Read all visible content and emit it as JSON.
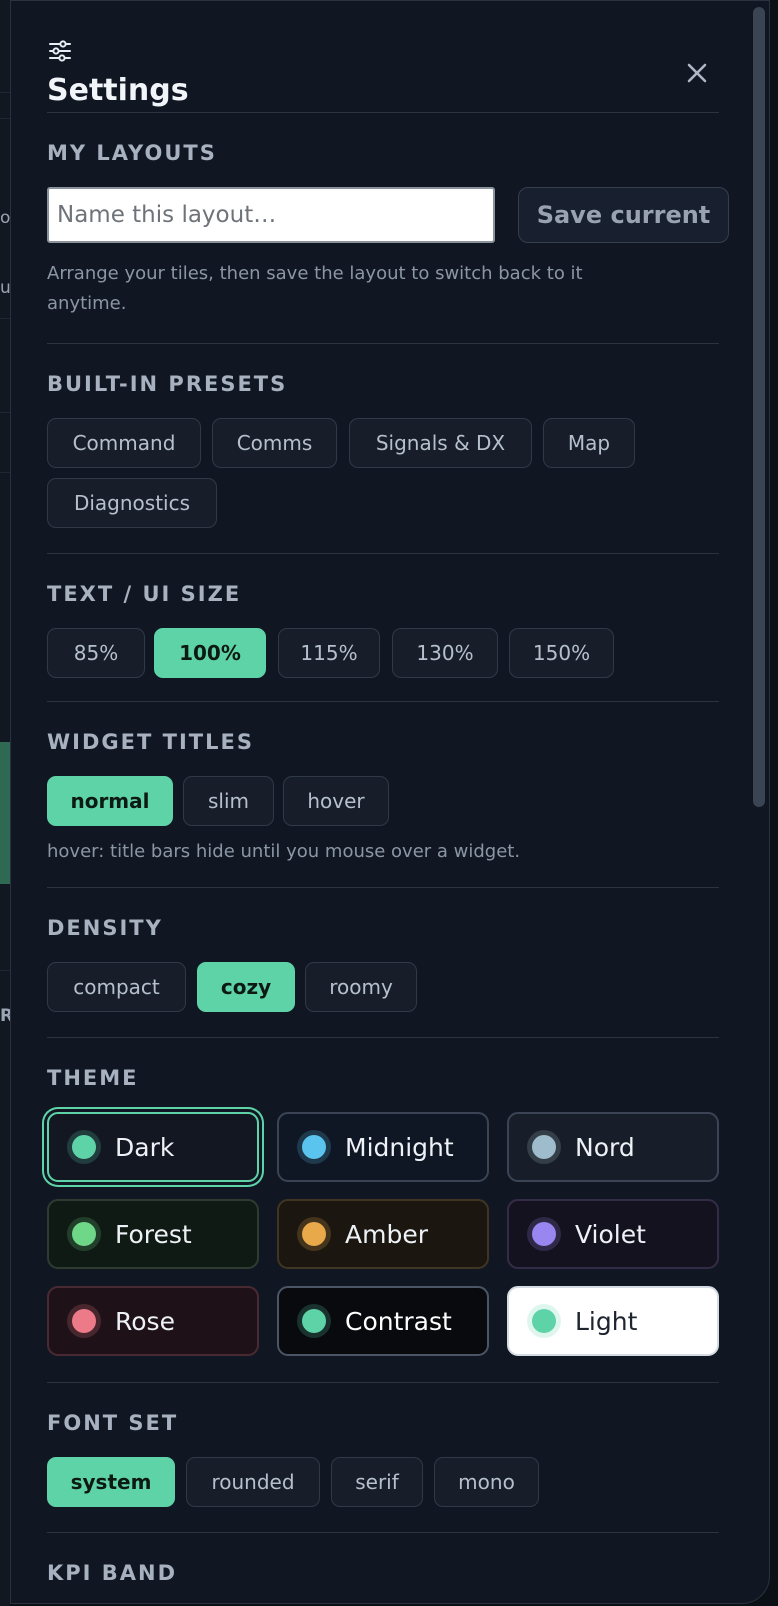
{
  "background": {
    "fragments": [
      "o",
      "u",
      "R"
    ]
  },
  "header": {
    "title": "Settings"
  },
  "my_layouts": {
    "title": "MY LAYOUTS",
    "input_placeholder": "Name this layout…",
    "save_label": "Save current",
    "note_line1": "Arrange your tiles, then save the layout to switch back to it",
    "note_line2": "anytime."
  },
  "presets": {
    "title": "BUILT-IN PRESETS",
    "items": [
      {
        "label": "Command"
      },
      {
        "label": "Comms"
      },
      {
        "label": "Signals & DX"
      },
      {
        "label": "Map"
      },
      {
        "label": "Diagnostics"
      }
    ]
  },
  "text_size": {
    "title": "TEXT / UI SIZE",
    "options": [
      {
        "label": "85%",
        "selected": false
      },
      {
        "label": "100%",
        "selected": true
      },
      {
        "label": "115%",
        "selected": false
      },
      {
        "label": "130%",
        "selected": false
      },
      {
        "label": "150%",
        "selected": false
      }
    ]
  },
  "widget_titles": {
    "title": "WIDGET TITLES",
    "options": [
      {
        "label": "normal",
        "selected": true
      },
      {
        "label": "slim",
        "selected": false
      },
      {
        "label": "hover",
        "selected": false
      }
    ],
    "note": "hover: title bars hide until you mouse over a widget."
  },
  "density": {
    "title": "DENSITY",
    "options": [
      {
        "label": "compact",
        "selected": false
      },
      {
        "label": "cozy",
        "selected": true
      },
      {
        "label": "roomy",
        "selected": false
      }
    ]
  },
  "theme": {
    "title": "THEME",
    "selected": "Dark",
    "options": [
      {
        "label": "Dark",
        "dot": "#5fd3a8",
        "bg": "#121722",
        "border": "#5fd3a8",
        "text": "#eef2f6"
      },
      {
        "label": "Midnight",
        "dot": "#5bc4ee",
        "bg": "#0f1624",
        "border": "#3a4454",
        "text": "#eef2f6"
      },
      {
        "label": "Nord",
        "dot": "#9fbccc",
        "bg": "#181e29",
        "border": "#3a4454",
        "text": "#eef2f6"
      },
      {
        "label": "Forest",
        "dot": "#6fd888",
        "bg": "#0f1a14",
        "border": "#2d3b30",
        "text": "#eef2f6"
      },
      {
        "label": "Amber",
        "dot": "#e8a94a",
        "bg": "#1b1710",
        "border": "#3f3522",
        "text": "#eef2f6"
      },
      {
        "label": "Violet",
        "dot": "#9a86f0",
        "bg": "#15121f",
        "border": "#342c47",
        "text": "#eef2f6"
      },
      {
        "label": "Rose",
        "dot": "#ec7a88",
        "bg": "#1e1218",
        "border": "#4a2a32",
        "text": "#eef2f6"
      },
      {
        "label": "Contrast",
        "dot": "#5fd3a8",
        "bg": "#080a0e",
        "border": "#4a5565",
        "text": "#ffffff"
      },
      {
        "label": "Light",
        "dot": "#5fd3a8",
        "bg": "#ffffff",
        "border": "#d5dbe2",
        "text": "#1e2530"
      }
    ]
  },
  "font_set": {
    "title": "FONT SET",
    "options": [
      {
        "label": "system",
        "selected": true
      },
      {
        "label": "rounded",
        "selected": false
      },
      {
        "label": "serif",
        "selected": false
      },
      {
        "label": "mono",
        "selected": false
      }
    ]
  },
  "kpi_band": {
    "title": "KPI BAND"
  },
  "colors": {
    "accent": "#5fd3a8",
    "panel": "#111722"
  },
  "icons": {
    "header": "sliders-icon",
    "close": "close-icon"
  }
}
